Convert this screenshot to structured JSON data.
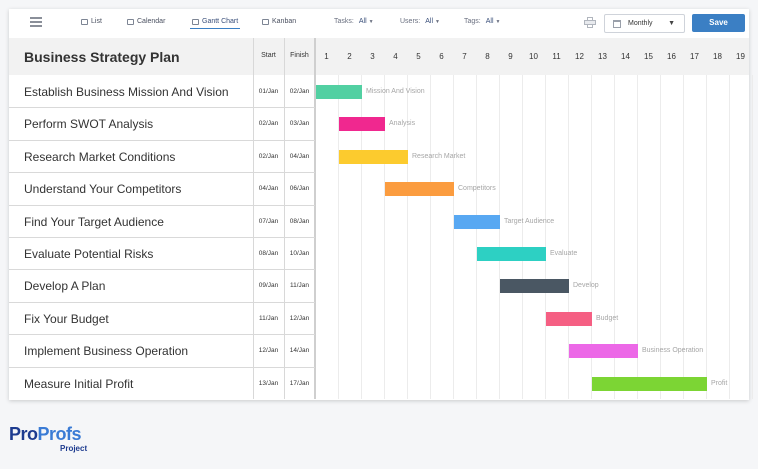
{
  "toolbar": {
    "views": [
      {
        "label": "List",
        "icon": "list-icon"
      },
      {
        "label": "Calendar",
        "icon": "calendar-icon"
      },
      {
        "label": "Gantt Chart",
        "icon": "gantt-icon",
        "active": true
      },
      {
        "label": "Kanban",
        "icon": "kanban-icon"
      }
    ],
    "filters": [
      {
        "label": "Tasks:",
        "value": "All"
      },
      {
        "label": "Users:",
        "value": "All"
      },
      {
        "label": "Tags:",
        "value": "All"
      }
    ],
    "period": "Monthly",
    "save_label": "Save"
  },
  "gantt": {
    "title": "Business Strategy Plan",
    "start_header": "Start",
    "finish_header": "Finish",
    "days": [
      "1",
      "2",
      "3",
      "4",
      "5",
      "6",
      "7",
      "8",
      "9",
      "10",
      "11",
      "12",
      "13",
      "14",
      "15",
      "16",
      "17",
      "18",
      "19"
    ],
    "tasks": [
      {
        "name": "Establish Business Mission And Vision",
        "start": "01/Jan",
        "finish": "02/Jan",
        "bar_label": "Mission And Vision",
        "from_day": 1,
        "to_day": 2,
        "color": "#52d0a2"
      },
      {
        "name": "Perform SWOT Analysis",
        "start": "02/Jan",
        "finish": "03/Jan",
        "bar_label": "Analysis",
        "from_day": 2,
        "to_day": 3,
        "color": "#f0288f"
      },
      {
        "name": "Research Market Conditions",
        "start": "02/Jan",
        "finish": "04/Jan",
        "bar_label": "Research Market",
        "from_day": 2,
        "to_day": 4,
        "color": "#fccb2e"
      },
      {
        "name": "Understand Your Competitors",
        "start": "04/Jan",
        "finish": "06/Jan",
        "bar_label": "Competitors",
        "from_day": 4,
        "to_day": 6,
        "color": "#fb9c3f"
      },
      {
        "name": "Find Your Target Audience",
        "start": "07/Jan",
        "finish": "08/Jan",
        "bar_label": "Target Audience",
        "from_day": 7,
        "to_day": 8,
        "color": "#58a8f2"
      },
      {
        "name": "Evaluate Potential Risks",
        "start": "08/Jan",
        "finish": "10/Jan",
        "bar_label": "Evaluate",
        "from_day": 8,
        "to_day": 10,
        "color": "#2dd0c3"
      },
      {
        "name": "Develop A Plan",
        "start": "09/Jan",
        "finish": "11/Jan",
        "bar_label": "Develop",
        "from_day": 9,
        "to_day": 11,
        "color": "#4a5763"
      },
      {
        "name": "Fix Your Budget",
        "start": "11/Jan",
        "finish": "12/Jan",
        "bar_label": "Budget",
        "from_day": 11,
        "to_day": 12,
        "color": "#f55f83"
      },
      {
        "name": "Implement Business Operation",
        "start": "12/Jan",
        "finish": "14/Jan",
        "bar_label": "Business Operation",
        "from_day": 12,
        "to_day": 14,
        "color": "#ec68e7"
      },
      {
        "name": "Measure Initial Profit",
        "start": "13/Jan",
        "finish": "17/Jan",
        "bar_label": "Profit",
        "from_day": 13,
        "to_day": 17,
        "color": "#7cd534"
      }
    ]
  },
  "logo": {
    "main_pro": "Pro",
    "main_profs": "Profs",
    "sub": "Project"
  }
}
